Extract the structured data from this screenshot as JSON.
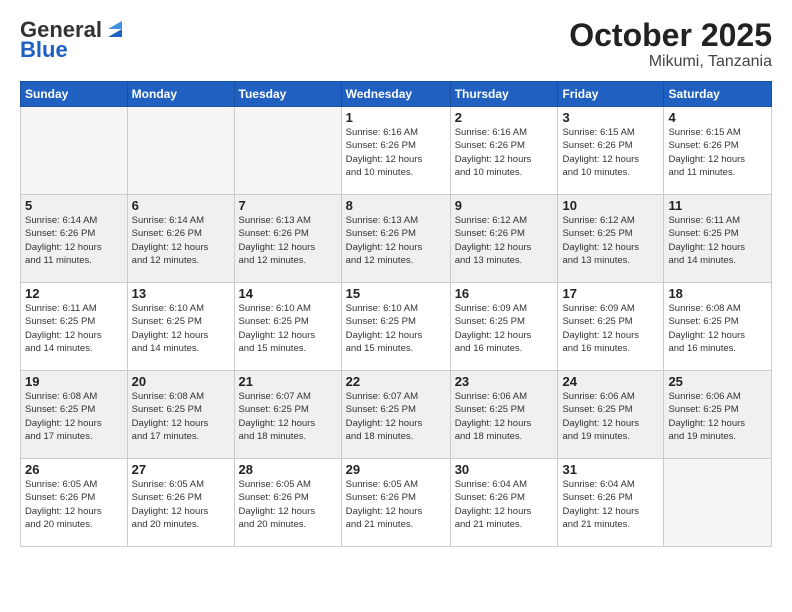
{
  "logo": {
    "general": "General",
    "blue": "Blue"
  },
  "header": {
    "month_year": "October 2025",
    "location": "Mikumi, Tanzania"
  },
  "weekdays": [
    "Sunday",
    "Monday",
    "Tuesday",
    "Wednesday",
    "Thursday",
    "Friday",
    "Saturday"
  ],
  "weeks": [
    [
      {
        "day": "",
        "info": ""
      },
      {
        "day": "",
        "info": ""
      },
      {
        "day": "",
        "info": ""
      },
      {
        "day": "1",
        "info": "Sunrise: 6:16 AM\nSunset: 6:26 PM\nDaylight: 12 hours\nand 10 minutes."
      },
      {
        "day": "2",
        "info": "Sunrise: 6:16 AM\nSunset: 6:26 PM\nDaylight: 12 hours\nand 10 minutes."
      },
      {
        "day": "3",
        "info": "Sunrise: 6:15 AM\nSunset: 6:26 PM\nDaylight: 12 hours\nand 10 minutes."
      },
      {
        "day": "4",
        "info": "Sunrise: 6:15 AM\nSunset: 6:26 PM\nDaylight: 12 hours\nand 11 minutes."
      }
    ],
    [
      {
        "day": "5",
        "info": "Sunrise: 6:14 AM\nSunset: 6:26 PM\nDaylight: 12 hours\nand 11 minutes."
      },
      {
        "day": "6",
        "info": "Sunrise: 6:14 AM\nSunset: 6:26 PM\nDaylight: 12 hours\nand 12 minutes."
      },
      {
        "day": "7",
        "info": "Sunrise: 6:13 AM\nSunset: 6:26 PM\nDaylight: 12 hours\nand 12 minutes."
      },
      {
        "day": "8",
        "info": "Sunrise: 6:13 AM\nSunset: 6:26 PM\nDaylight: 12 hours\nand 12 minutes."
      },
      {
        "day": "9",
        "info": "Sunrise: 6:12 AM\nSunset: 6:26 PM\nDaylight: 12 hours\nand 13 minutes."
      },
      {
        "day": "10",
        "info": "Sunrise: 6:12 AM\nSunset: 6:25 PM\nDaylight: 12 hours\nand 13 minutes."
      },
      {
        "day": "11",
        "info": "Sunrise: 6:11 AM\nSunset: 6:25 PM\nDaylight: 12 hours\nand 14 minutes."
      }
    ],
    [
      {
        "day": "12",
        "info": "Sunrise: 6:11 AM\nSunset: 6:25 PM\nDaylight: 12 hours\nand 14 minutes."
      },
      {
        "day": "13",
        "info": "Sunrise: 6:10 AM\nSunset: 6:25 PM\nDaylight: 12 hours\nand 14 minutes."
      },
      {
        "day": "14",
        "info": "Sunrise: 6:10 AM\nSunset: 6:25 PM\nDaylight: 12 hours\nand 15 minutes."
      },
      {
        "day": "15",
        "info": "Sunrise: 6:10 AM\nSunset: 6:25 PM\nDaylight: 12 hours\nand 15 minutes."
      },
      {
        "day": "16",
        "info": "Sunrise: 6:09 AM\nSunset: 6:25 PM\nDaylight: 12 hours\nand 16 minutes."
      },
      {
        "day": "17",
        "info": "Sunrise: 6:09 AM\nSunset: 6:25 PM\nDaylight: 12 hours\nand 16 minutes."
      },
      {
        "day": "18",
        "info": "Sunrise: 6:08 AM\nSunset: 6:25 PM\nDaylight: 12 hours\nand 16 minutes."
      }
    ],
    [
      {
        "day": "19",
        "info": "Sunrise: 6:08 AM\nSunset: 6:25 PM\nDaylight: 12 hours\nand 17 minutes."
      },
      {
        "day": "20",
        "info": "Sunrise: 6:08 AM\nSunset: 6:25 PM\nDaylight: 12 hours\nand 17 minutes."
      },
      {
        "day": "21",
        "info": "Sunrise: 6:07 AM\nSunset: 6:25 PM\nDaylight: 12 hours\nand 18 minutes."
      },
      {
        "day": "22",
        "info": "Sunrise: 6:07 AM\nSunset: 6:25 PM\nDaylight: 12 hours\nand 18 minutes."
      },
      {
        "day": "23",
        "info": "Sunrise: 6:06 AM\nSunset: 6:25 PM\nDaylight: 12 hours\nand 18 minutes."
      },
      {
        "day": "24",
        "info": "Sunrise: 6:06 AM\nSunset: 6:25 PM\nDaylight: 12 hours\nand 19 minutes."
      },
      {
        "day": "25",
        "info": "Sunrise: 6:06 AM\nSunset: 6:25 PM\nDaylight: 12 hours\nand 19 minutes."
      }
    ],
    [
      {
        "day": "26",
        "info": "Sunrise: 6:05 AM\nSunset: 6:26 PM\nDaylight: 12 hours\nand 20 minutes."
      },
      {
        "day": "27",
        "info": "Sunrise: 6:05 AM\nSunset: 6:26 PM\nDaylight: 12 hours\nand 20 minutes."
      },
      {
        "day": "28",
        "info": "Sunrise: 6:05 AM\nSunset: 6:26 PM\nDaylight: 12 hours\nand 20 minutes."
      },
      {
        "day": "29",
        "info": "Sunrise: 6:05 AM\nSunset: 6:26 PM\nDaylight: 12 hours\nand 21 minutes."
      },
      {
        "day": "30",
        "info": "Sunrise: 6:04 AM\nSunset: 6:26 PM\nDaylight: 12 hours\nand 21 minutes."
      },
      {
        "day": "31",
        "info": "Sunrise: 6:04 AM\nSunset: 6:26 PM\nDaylight: 12 hours\nand 21 minutes."
      },
      {
        "day": "",
        "info": ""
      }
    ]
  ]
}
